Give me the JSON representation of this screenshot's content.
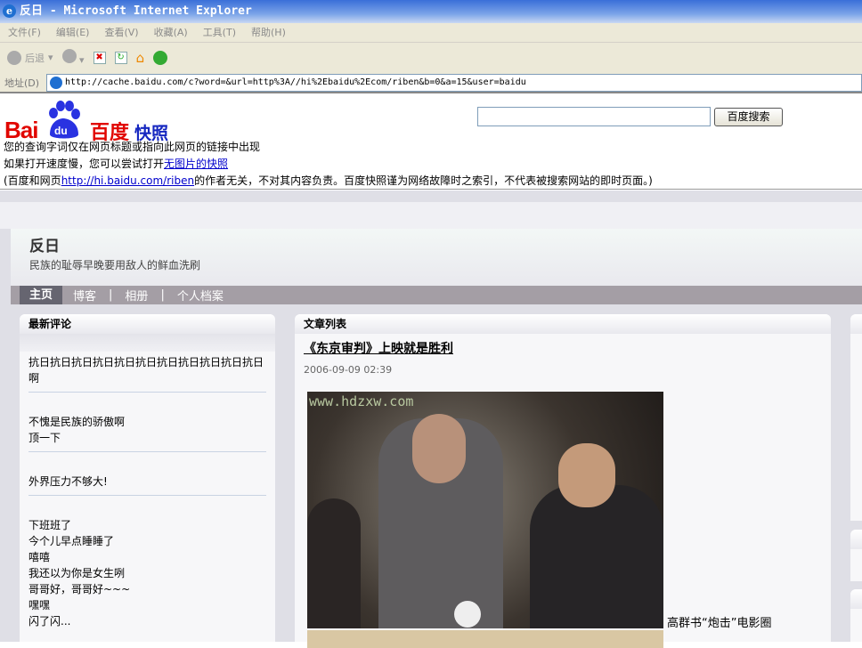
{
  "window": {
    "title": "反日 - Microsoft Internet Explorer"
  },
  "menu": [
    "文件(F)",
    "编辑(E)",
    "查看(V)",
    "收藏(A)",
    "工具(T)",
    "帮助(H)"
  ],
  "toolbar": {
    "back_label": "后退"
  },
  "address": {
    "label": "地址(D)",
    "url": "http://cache.baidu.com/c?word=&url=http%3A//hi%2Ebaidu%2Ecom/riben&b=0&a=15&user=baidu"
  },
  "snapshot": {
    "logo": {
      "bai": "Bai",
      "du": "du",
      "cn": "百度",
      "kuaizhao": "快照"
    },
    "search_value": "",
    "search_button": "百度搜索",
    "line1": "您的查询字词仅在网页标题或指向此网页的链接中出现",
    "line2_prefix": "如果打开速度慢，您可以尝试打开",
    "line2_link": "无图片的快照",
    "line3_prefix": "(百度和网页",
    "line3_link": "http://hi.baidu.com/riben",
    "line3_suffix": "的作者无关，不对其内容负责。百度快照谨为网络故障时之索引，不代表被搜索网站的即时页面。)"
  },
  "blog": {
    "title": "反日",
    "subtitle": "民族的耻辱早晚要用敌人的鲜血洗刷",
    "nav": [
      "主页",
      "博客",
      "相册",
      "个人档案"
    ],
    "nav_sep": "|"
  },
  "comments": {
    "heading": "最新评论",
    "items": [
      [
        "抗日抗日抗日抗日抗日抗日抗日抗日抗日抗日抗日",
        "啊"
      ],
      [
        "不愧是民族的骄傲啊",
        "顶一下"
      ],
      [
        "外界压力不够大!"
      ],
      [
        "下班班了",
        "今个儿早点睡睡了",
        "嘻嘻",
        "我还以为你是女生咧",
        "哥哥好，哥哥好~~~",
        "嘿嘿",
        "闪了闪..."
      ]
    ]
  },
  "articles": {
    "heading": "文章列表",
    "title": "《东京审判》上映就是胜利",
    "date": "2006-09-09 02:39",
    "image_watermark": "www.hdzxw.com",
    "caption": "高群书“炮击”电影圈"
  }
}
